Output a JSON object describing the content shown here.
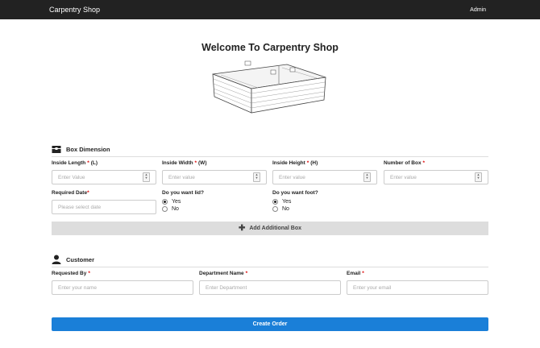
{
  "nav": {
    "brand": "Carpentry Shop",
    "user": "Admin"
  },
  "page": {
    "title": "Welcome To Carpentry Shop"
  },
  "box_section": {
    "heading": "Box Dimension",
    "icon": "box-icon",
    "fields": {
      "length": {
        "label": "Inside Length",
        "suffix": "(L)",
        "placeholder": "Enter Value"
      },
      "width": {
        "label": "Inside Width",
        "suffix": "(W)",
        "placeholder": "Enter value"
      },
      "height": {
        "label": "Inside Height",
        "suffix": "(H)",
        "placeholder": "Enter value"
      },
      "count": {
        "label": "Number of Box",
        "placeholder": "Enter value"
      },
      "date": {
        "label": "Required Date",
        "placeholder": "Please select date"
      }
    },
    "lid": {
      "question": "Do you want lid?",
      "yes": "Yes",
      "no": "No",
      "selected": "Yes"
    },
    "foot": {
      "question": "Do you want foot?",
      "yes": "Yes",
      "no": "No",
      "selected": "Yes"
    },
    "add_button": "Add Additional Box",
    "required_mark": "*"
  },
  "customer_section": {
    "heading": "Customer",
    "icon": "user-icon",
    "fields": {
      "requested_by": {
        "label": "Requested By",
        "placeholder": "Enter your name"
      },
      "department": {
        "label": "Department Name",
        "placeholder": "Enter Department"
      },
      "email": {
        "label": "Email",
        "placeholder": "Enter your email"
      }
    }
  },
  "submit": "Create Order",
  "colors": {
    "navbar": "#222222",
    "primary": "#1a7fd8",
    "required": "#dd0000"
  }
}
